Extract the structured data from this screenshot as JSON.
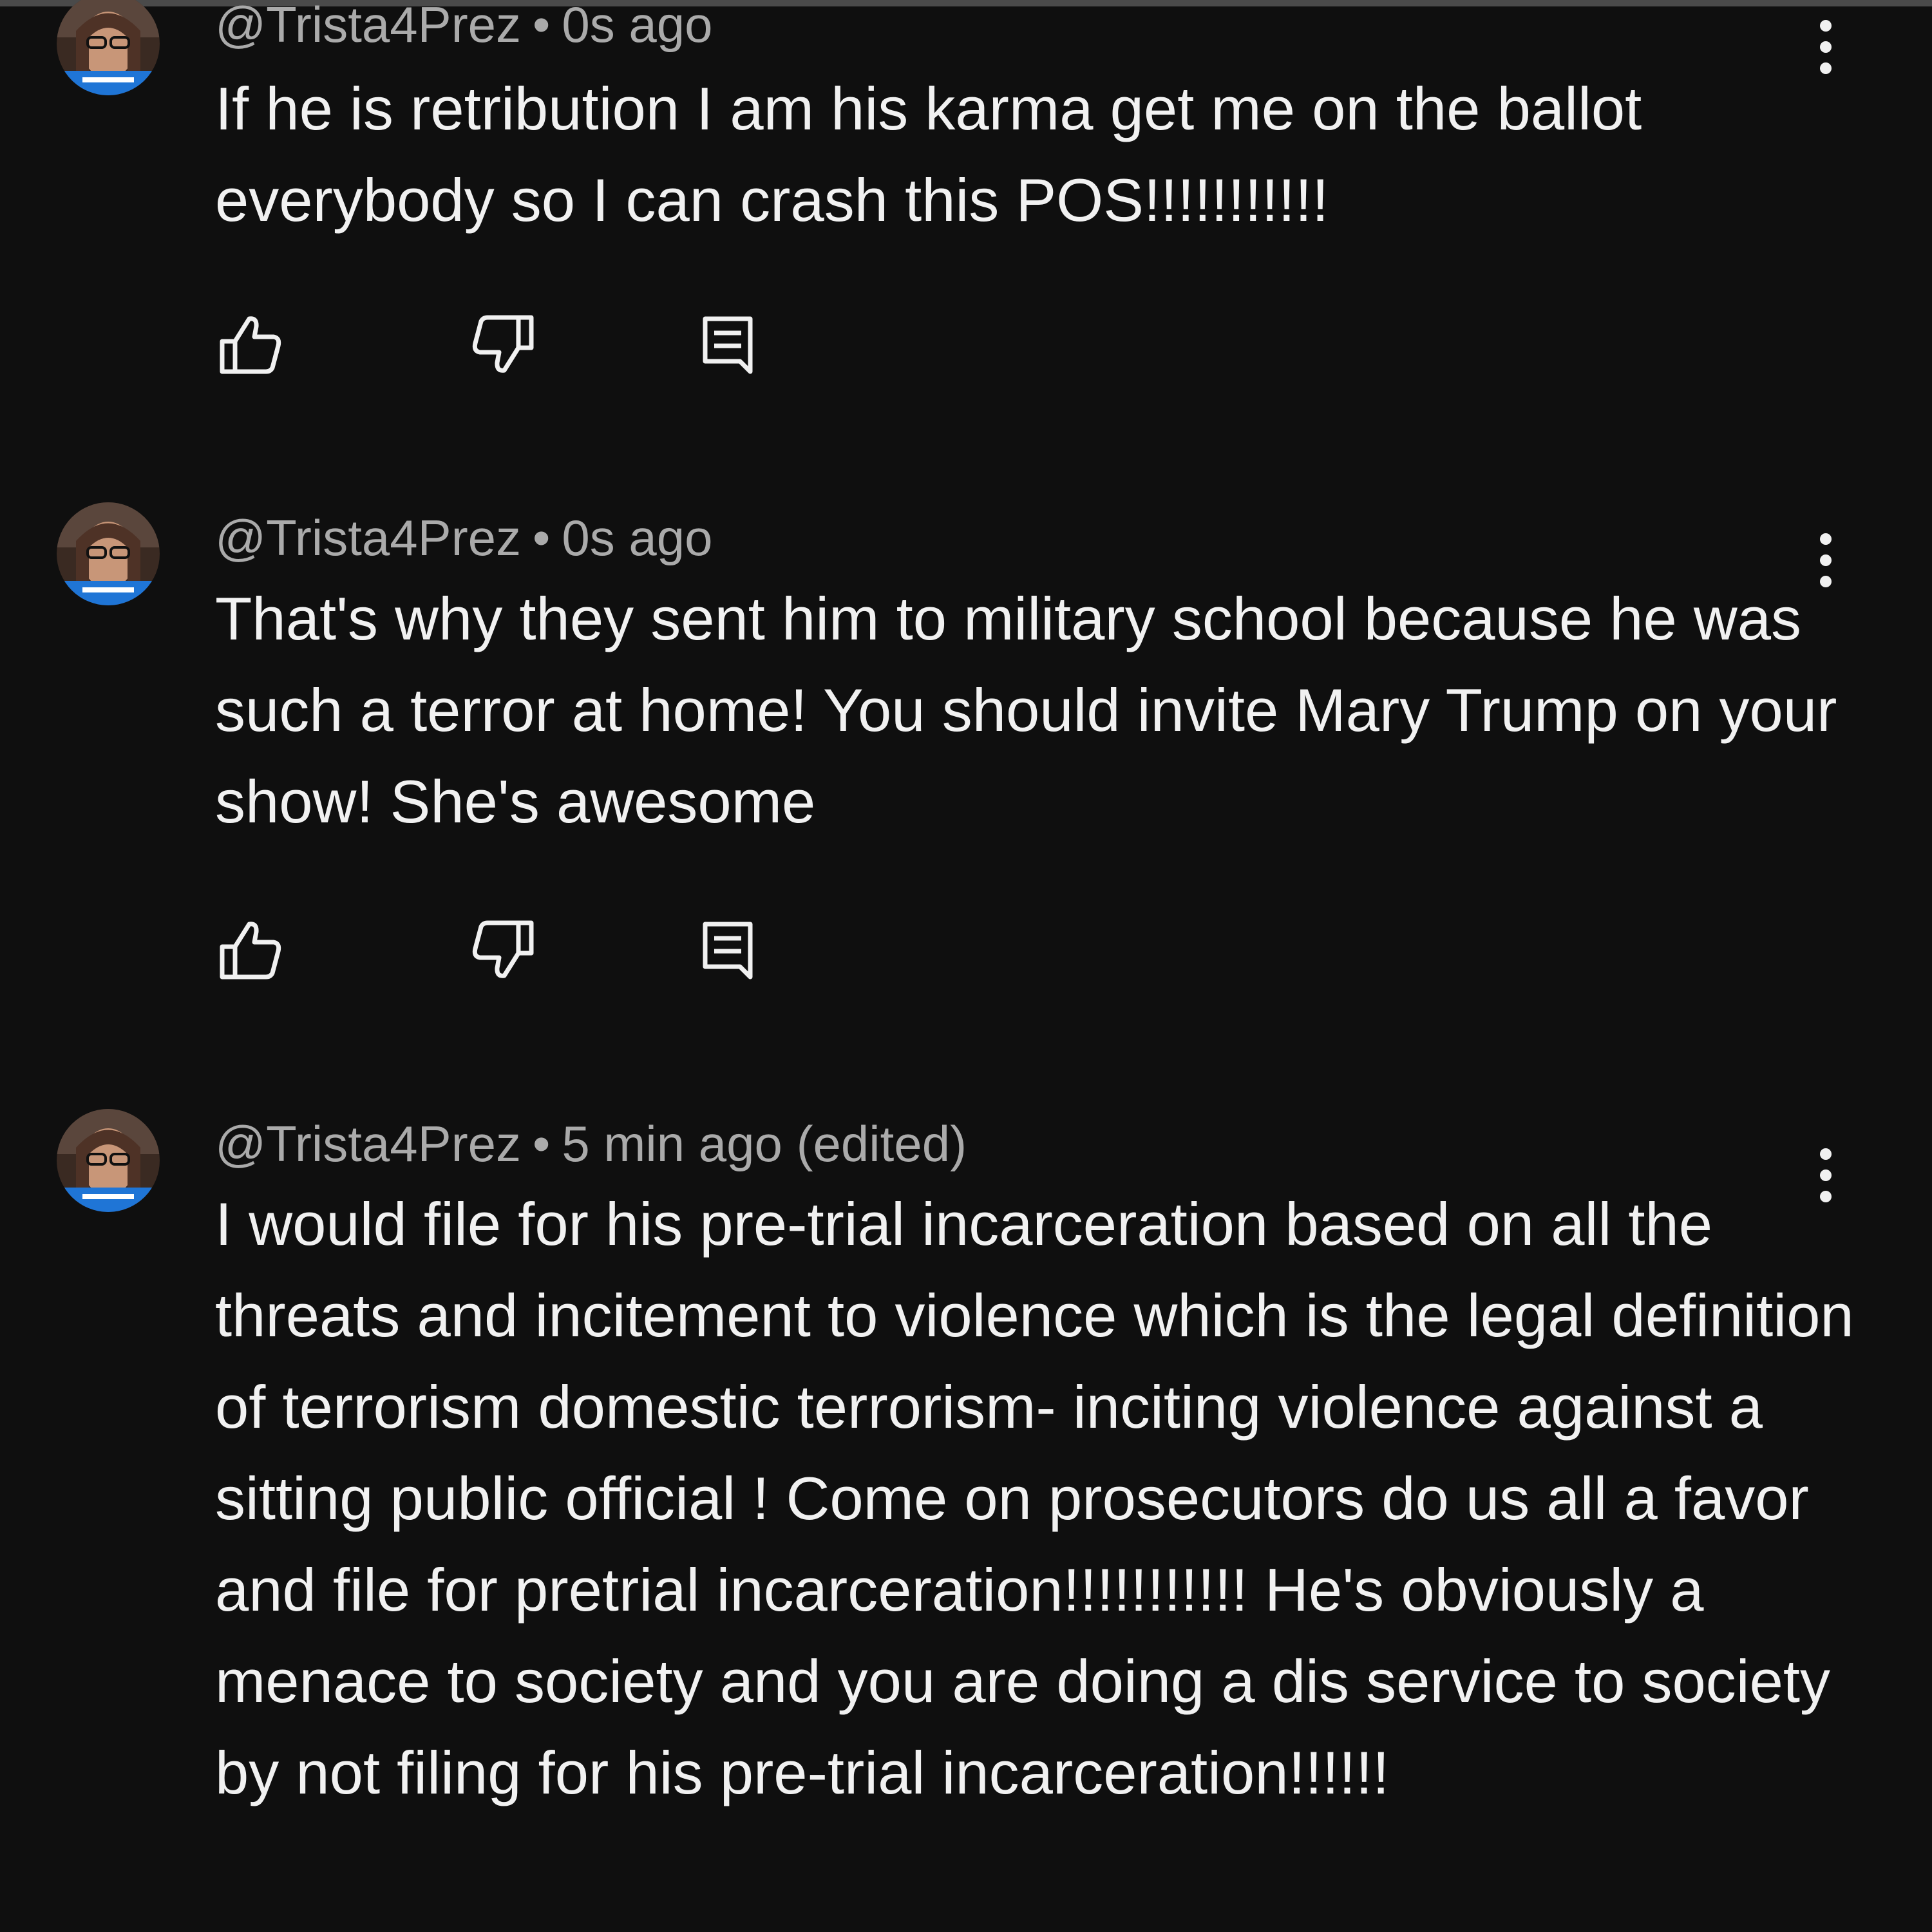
{
  "colors": {
    "background": "#0f0f0f",
    "text_primary": "#f1f1f1",
    "text_secondary": "#aaaaaa",
    "avatar_accent": "#1f75d6"
  },
  "icons": {
    "like": "thumb-up-outline",
    "dislike": "thumb-down-outline",
    "reply": "comment-reply-outline",
    "more": "vertical-ellipsis"
  },
  "comments": [
    {
      "handle": "@Trista4Prez",
      "separator": "•",
      "time": "0s ago",
      "text": "If he is retribution I am his karma get me on the ballot everybody so I can crash this POS!!!!!!!!!!!"
    },
    {
      "handle": "@Trista4Prez",
      "separator": "•",
      "time": "0s ago",
      "text": "That's why they sent him to military school because he was such a terror at home! You should invite Mary Trump on your show! She's awesome"
    },
    {
      "handle": "@Trista4Prez",
      "separator": "•",
      "time": "5 min ago (edited)",
      "text": "I would file for his pre-trial incarceration based on all the threats and incitement to violence which is the legal definition of terrorism domestic terrorism- inciting violence against a sitting public official ! Come on prosecutors do us all a favor and file for pretrial incarceration!!!!!!!!!!! He's obviously a menace to society and you are doing a dis service to society by not filing for his pre-trial incarceration!!!!!!"
    }
  ]
}
